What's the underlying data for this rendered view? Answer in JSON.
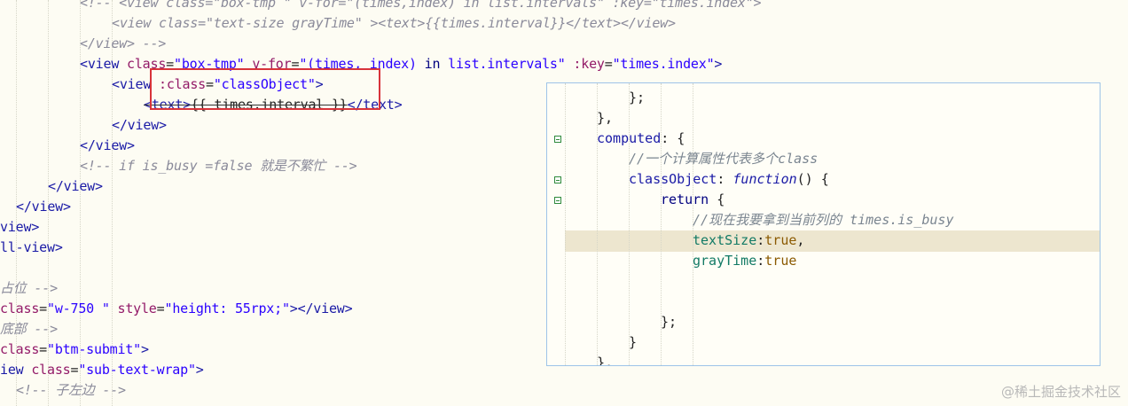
{
  "editor": {
    "lines": [
      {
        "t": "<!-- <view class=\"box-tmp \" v-for=\"(times,index) in list.intervals\" :key=\"times.index\">"
      },
      {
        "t": "<view class=\"text-size grayTime\" ><text>{{times.interval}}</text></view>"
      },
      {
        "t": "</view> -->"
      },
      {
        "a": "<view ",
        "b": "class",
        "c": "=",
        "d": "\"box-tmp\"",
        "e": " v-for",
        "f": "=",
        "g": "\"(times, index) ",
        "h": "in",
        "i": " list.intervals\"",
        "j": " :key",
        "k": "=",
        "l": "\"times.index\"",
        "m": ">"
      },
      {
        "a": "<view ",
        "b": ":class",
        "c": "=",
        "d": "\"classObject\"",
        "e": ">"
      },
      {
        "a": "<text>",
        "b": "{{ times.interval }}",
        "c": "</text>"
      },
      {
        "t": "</view>"
      },
      {
        "t": "</view>"
      },
      {
        "t": "<!-- if is_busy =false 就是不繁忙 -->"
      },
      {
        "t": "</view>"
      },
      {
        "t": "</view>"
      },
      {
        "t": "view>"
      },
      {
        "t": "ll-view>"
      },
      {
        "t": ""
      },
      {
        "t": "占位 -->"
      },
      {
        "a": "class",
        "b": "=",
        "c": "\"w-750 \"",
        "d": " style",
        "e": "=",
        "f": "\"height: 55rpx;\"",
        "g": "></view>"
      },
      {
        "t": "底部 -->"
      },
      {
        "a": "class",
        "b": "=",
        "c": "\"btm-submit\"",
        "d": ">"
      },
      {
        "a": "iew ",
        "b": "class",
        "c": "=",
        "d": "\"sub-text-wrap\"",
        "e": ">"
      },
      {
        "t": "<!-- 子左边 -->"
      }
    ]
  },
  "popup": {
    "lines": [
      {
        "t": "};"
      },
      {
        "t": "},"
      },
      {
        "a": "computed",
        "b": ": {"
      },
      {
        "t": "//一个计算属性代表多个class"
      },
      {
        "a": "classObject",
        "b": ": ",
        "c": "function",
        "d": "() {"
      },
      {
        "a": "return",
        "b": " {"
      },
      {
        "t": "//现在我要拿到当前列的 times.is_busy"
      },
      {
        "a": "textSize",
        "b": ":",
        "c": "true",
        "d": ","
      },
      {
        "a": "grayTime",
        "b": ":",
        "c": "true"
      },
      {
        "t": ""
      },
      {
        "t": ""
      },
      {
        "t": "};"
      },
      {
        "t": "}"
      },
      {
        "t": "},"
      }
    ]
  },
  "watermark": "@稀土掘金技术社区"
}
